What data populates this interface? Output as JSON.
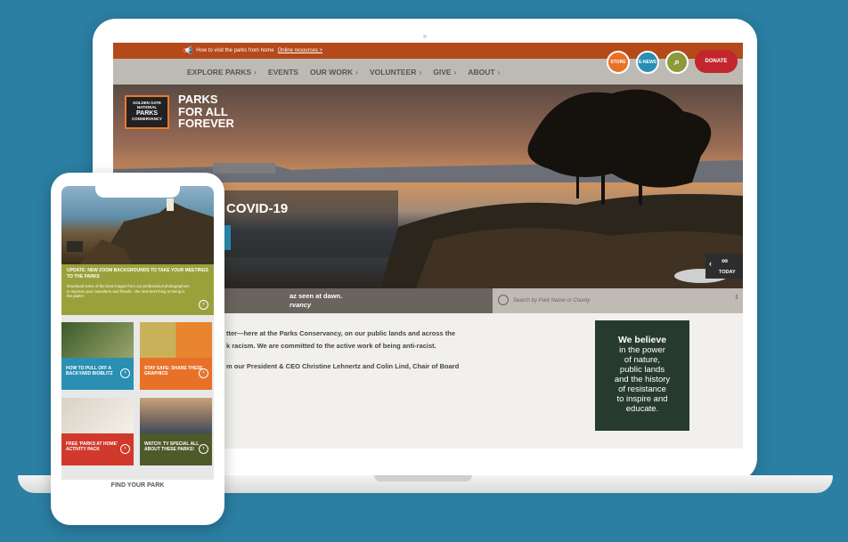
{
  "topbar": {
    "text": "How to visit the parks from home",
    "link": "Online resources >"
  },
  "nav": {
    "items": [
      {
        "label": "EXPLORE PARKS",
        "chev": "›"
      },
      {
        "label": "EVENTS",
        "chev": ""
      },
      {
        "label": "OUR WORK",
        "chev": "›"
      },
      {
        "label": "VOLUNTEER",
        "chev": "›"
      },
      {
        "label": "GIVE",
        "chev": "›"
      },
      {
        "label": "ABOUT",
        "chev": "›"
      }
    ],
    "store": "STORE",
    "enews": "E-NEWS",
    "donate": "DONATE"
  },
  "logo": {
    "line1": "GOLDEN GATE",
    "line2": "NATIONAL",
    "line3": "PARKS",
    "line4": "CONSERVANCY"
  },
  "hero": {
    "tag1": "PARKS",
    "tag2": "FOR ALL",
    "tag3": "FOREVER",
    "headline": "COVID-19",
    "today": "TODAY"
  },
  "caption": {
    "line1": "az seen at dawn.",
    "line2": "rvancy"
  },
  "search": {
    "placeholder": "Search by Park Name or County"
  },
  "body": {
    "p1a": "tter—here at the Parks Conservancy, on our public lands and across the",
    "p1b": "k racism. We are committed to the active work of being anti-racist.",
    "p2": "m our President & CEO Christine Lehnertz and Colin Lind, Chair of Board"
  },
  "believe": {
    "l1": "We believe",
    "l2": "in the power",
    "l3": "of nature,",
    "l4": "public lands",
    "l5": "and the history",
    "l6": "of resistance",
    "l7": "to inspire and",
    "l8": "educate."
  },
  "phone": {
    "update_title": "UPDATE: NEW ZOOM BACKGROUNDS TO TAKE YOUR MEETINGS TO THE PARKS",
    "update_sub": "Download some of the best images from our professional photographers to impress your coworkers and friends - the next best thing to being in the parks!",
    "card1": "HOW TO PULL OFF A BACKYARD BIOBLITZ",
    "card2": "STAY SAFE: SHARE THESE GRAPHICS",
    "card3": "FREE 'PARKS AT HOME' ACTIVITY PACK",
    "card4": "WATCH: TV SPECIAL ALL ABOUT THESE PARKS!",
    "find": "FIND YOUR PARK"
  }
}
